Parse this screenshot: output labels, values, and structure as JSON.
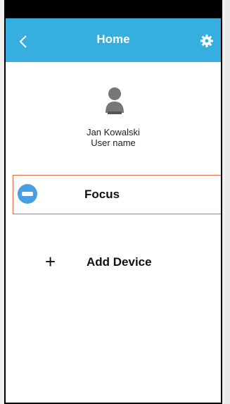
{
  "header": {
    "title": "Home",
    "back_icon": "chevron-left-icon",
    "settings_icon": "gear-icon",
    "color": "#36afe0"
  },
  "profile": {
    "avatar_icon": "user-icon",
    "name": "Jan Kowalski",
    "subtitle": "User name"
  },
  "devices": [
    {
      "name": "Focus",
      "icon": "air-conditioner-icon",
      "selected": true
    }
  ],
  "add_device": {
    "label": "Add Device",
    "icon": "plus-icon",
    "icon_glyph": "+"
  }
}
